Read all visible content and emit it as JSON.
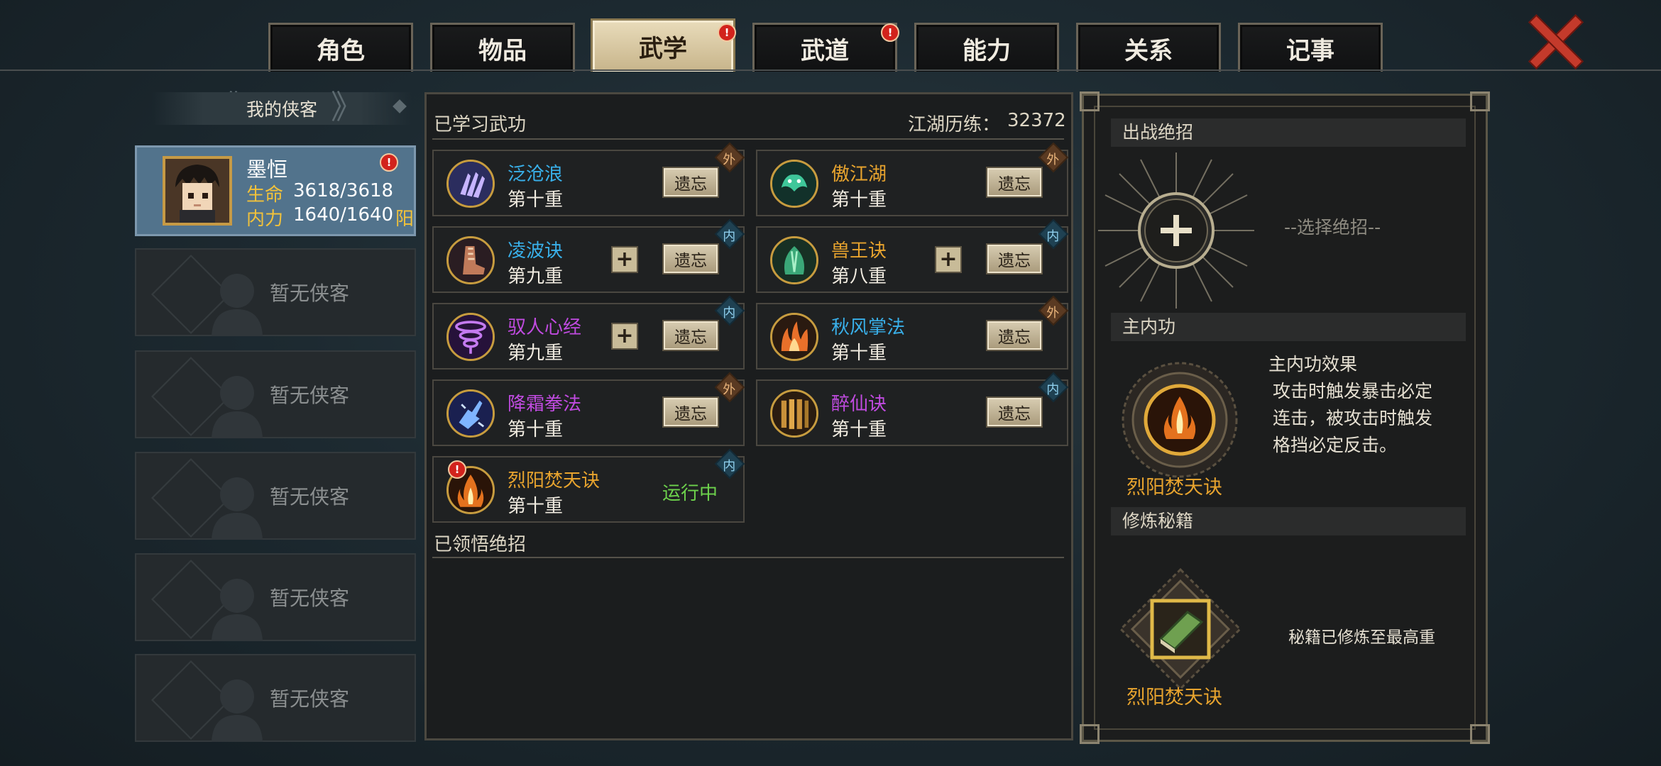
{
  "tabs": [
    {
      "label": "角色",
      "active": false,
      "alert": false
    },
    {
      "label": "物品",
      "active": false,
      "alert": false
    },
    {
      "label": "武学",
      "active": true,
      "alert": true
    },
    {
      "label": "武道",
      "active": false,
      "alert": true
    },
    {
      "label": "能力",
      "active": false,
      "alert": false
    },
    {
      "label": "关系",
      "active": false,
      "alert": false
    },
    {
      "label": "记事",
      "active": false,
      "alert": false
    }
  ],
  "left": {
    "header": "我的侠客",
    "character": {
      "name": "墨恒",
      "hp_label": "生命",
      "hp": "3618/3618",
      "mp_label": "内力",
      "mp": "1640/1640",
      "attr": "阳"
    },
    "empty_label": "暂无侠客",
    "empty_slots": 5
  },
  "middle": {
    "learned_title": "已学习武功",
    "experience_label": "江湖历练：",
    "experience_value": "32372",
    "forget_label": "遗忘",
    "running_label": "运行中",
    "skills": [
      {
        "name": "泛沧浪",
        "level": "第十重",
        "color": "blue",
        "type": "外",
        "plus": false,
        "icon": "claw-icon"
      },
      {
        "name": "傲江湖",
        "level": "第十重",
        "color": "orange",
        "type": "外",
        "plus": false,
        "icon": "dragon-icon"
      },
      {
        "name": "凌波诀",
        "level": "第九重",
        "color": "blue",
        "type": "内",
        "plus": true,
        "icon": "boot-icon"
      },
      {
        "name": "兽王诀",
        "level": "第八重",
        "color": "orange",
        "type": "内",
        "plus": true,
        "icon": "beast-icon"
      },
      {
        "name": "驭人心经",
        "level": "第九重",
        "color": "purple",
        "type": "内",
        "plus": true,
        "icon": "vortex-icon"
      },
      {
        "name": "秋风掌法",
        "level": "第十重",
        "color": "blue",
        "type": "外",
        "plus": false,
        "icon": "flame-palm-icon"
      },
      {
        "name": "降霜拳法",
        "level": "第十重",
        "color": "purple",
        "type": "外",
        "plus": false,
        "icon": "frost-fist-icon"
      },
      {
        "name": "醉仙诀",
        "level": "第十重",
        "color": "purple",
        "type": "内",
        "plus": false,
        "icon": "scroll-icon"
      },
      {
        "name": "烈阳焚天诀",
        "level": "第十重",
        "color": "orange",
        "type": "内",
        "plus": false,
        "running": true,
        "alert": true,
        "icon": "sun-flame-icon"
      }
    ],
    "ultimate_title": "已领悟绝招"
  },
  "right": {
    "battle_title": "出战绝招",
    "select_label": "--选择绝招--",
    "main_inner_title": "主内功",
    "effect_title": "主内功效果",
    "effect_text": [
      "攻击时触发暴击必定",
      "连击，被攻击时触发",
      "格挡必定反击。"
    ],
    "main_inner_name": "烈阳焚天诀",
    "cultivate_title": "修炼秘籍",
    "cultivate_status": "秘籍已修炼至最高重",
    "book_name": "烈阳焚天诀"
  },
  "colors": {
    "blue": "#39b0ea",
    "orange": "#e8a42e",
    "purple": "#c04be0",
    "running": "#6dd24c",
    "alert": "#d2231c"
  }
}
